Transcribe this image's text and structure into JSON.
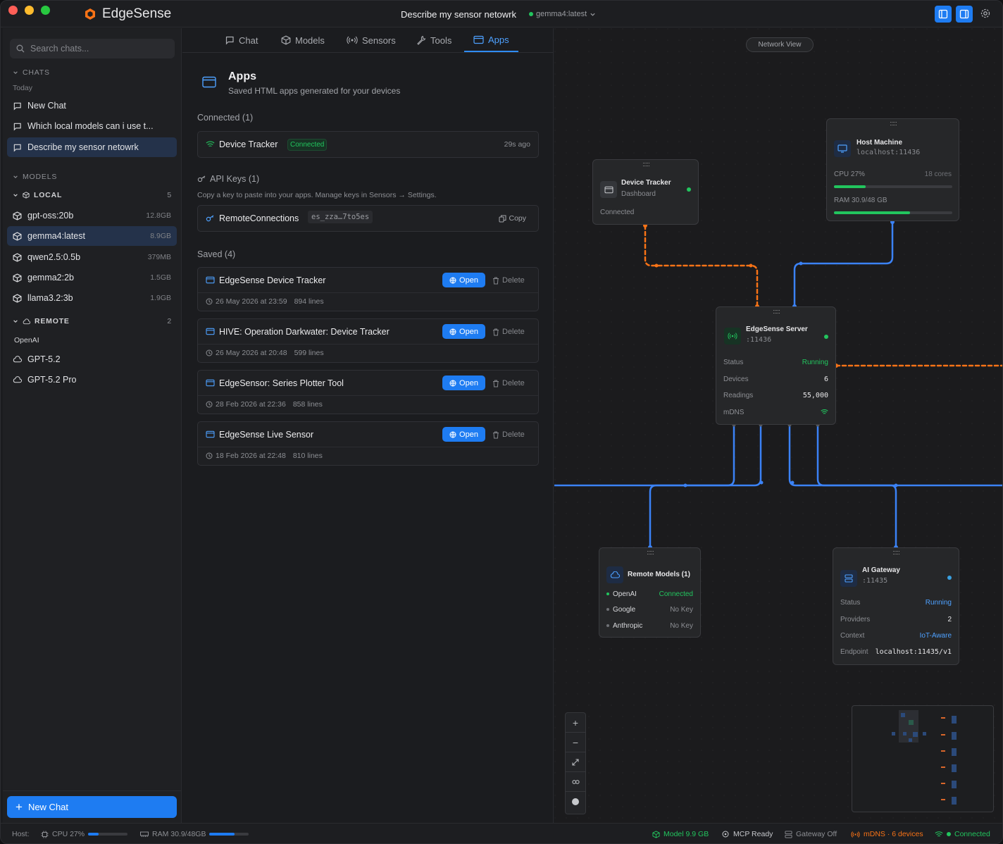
{
  "window": {
    "app_name": "EdgeSense",
    "title": "Describe my sensor netowrk",
    "model": "gemma4:latest"
  },
  "sidebar": {
    "search_placeholder": "Search chats...",
    "chats_header": "CHATS",
    "today": "Today",
    "chats": [
      "New Chat",
      "Which local models can i use t...",
      "Describe my sensor netowrk"
    ],
    "models_header": "MODELS",
    "local_header": "LOCAL",
    "local_count": "5",
    "local": [
      {
        "name": "gpt-oss:20b",
        "size": "12.8GB"
      },
      {
        "name": "gemma4:latest",
        "size": "8.9GB"
      },
      {
        "name": "qwen2.5:0.5b",
        "size": "379MB"
      },
      {
        "name": "gemma2:2b",
        "size": "1.5GB"
      },
      {
        "name": "llama3.2:3b",
        "size": "1.9GB"
      }
    ],
    "remote_header": "REMOTE",
    "remote_count": "2",
    "provider": "OpenAI",
    "remote": [
      "GPT-5.2",
      "GPT-5.2 Pro"
    ],
    "new_chat": "New Chat"
  },
  "tabs": [
    "Chat",
    "Models",
    "Sensors",
    "Tools",
    "Apps"
  ],
  "apps": {
    "title": "Apps",
    "subtitle": "Saved HTML apps generated for your devices",
    "connected_label": "Connected (1)",
    "connected": {
      "name": "Device Tracker",
      "badge": "Connected",
      "time": "29s ago"
    },
    "api_label": "API Keys (1)",
    "api_hint": "Copy a key to paste into your apps. Manage keys in Sensors → Settings.",
    "api": {
      "name": "RemoteConnections",
      "key": "es_zza…7to5es",
      "copy": "Copy"
    },
    "saved_label": "Saved (4)",
    "open": "Open",
    "delete": "Delete",
    "saved": [
      {
        "name": "EdgeSense Device Tracker",
        "date": "26 May 2026 at 23:59",
        "lines": "894 lines"
      },
      {
        "name": "HIVE: Operation Darkwater: Device Tracker",
        "date": "26 May 2026 at 20:48",
        "lines": "599 lines"
      },
      {
        "name": "EdgeSensor: Series Plotter Tool",
        "date": "28 Feb 2026 at 22:36",
        "lines": "858 lines"
      },
      {
        "name": "EdgeSense Live Sensor",
        "date": "18 Feb 2026 at 22:48",
        "lines": "810 lines"
      }
    ]
  },
  "network": {
    "label": "Network View",
    "tracker": {
      "title": "Device Tracker",
      "sub": "Dashboard",
      "status": "Connected"
    },
    "host": {
      "title": "Host Machine",
      "addr": "localhost:11436",
      "cpu": "CPU 27%",
      "cores": "18 cores",
      "ram": "RAM 30.9/48 GB",
      "cpu_pct": 0.27,
      "ram_pct": 0.64
    },
    "server": {
      "title": "EdgeSense Server",
      "port": ":11436",
      "rows": [
        [
          "Status",
          "Running"
        ],
        [
          "Devices",
          "6"
        ],
        [
          "Readings",
          "55,000"
        ],
        [
          "mDNS",
          ""
        ]
      ]
    },
    "remote": {
      "title": "Remote Models (1)",
      "rows": [
        [
          "OpenAI",
          "Connected"
        ],
        [
          "Google",
          "No Key"
        ],
        [
          "Anthropic",
          "No Key"
        ]
      ]
    },
    "gateway": {
      "title": "AI Gateway",
      "port": ":11435",
      "rows": [
        [
          "Status",
          "Running"
        ],
        [
          "Providers",
          "2"
        ],
        [
          "Context",
          "IoT-Aware"
        ],
        [
          "Endpoint",
          "localhost:11435/v1"
        ]
      ]
    }
  },
  "status": {
    "host": "Host:",
    "cpu": "CPU 27%",
    "ram": "RAM 30.9/48GB",
    "model": "Model 9.9 GB",
    "mcp": "MCP Ready",
    "gateway": "Gateway Off",
    "mdns": "mDNS · 6 devices",
    "conn": "Connected"
  },
  "colors": {
    "accent": "#1e7cf2",
    "green": "#22c55e",
    "orange": "#f97316"
  }
}
